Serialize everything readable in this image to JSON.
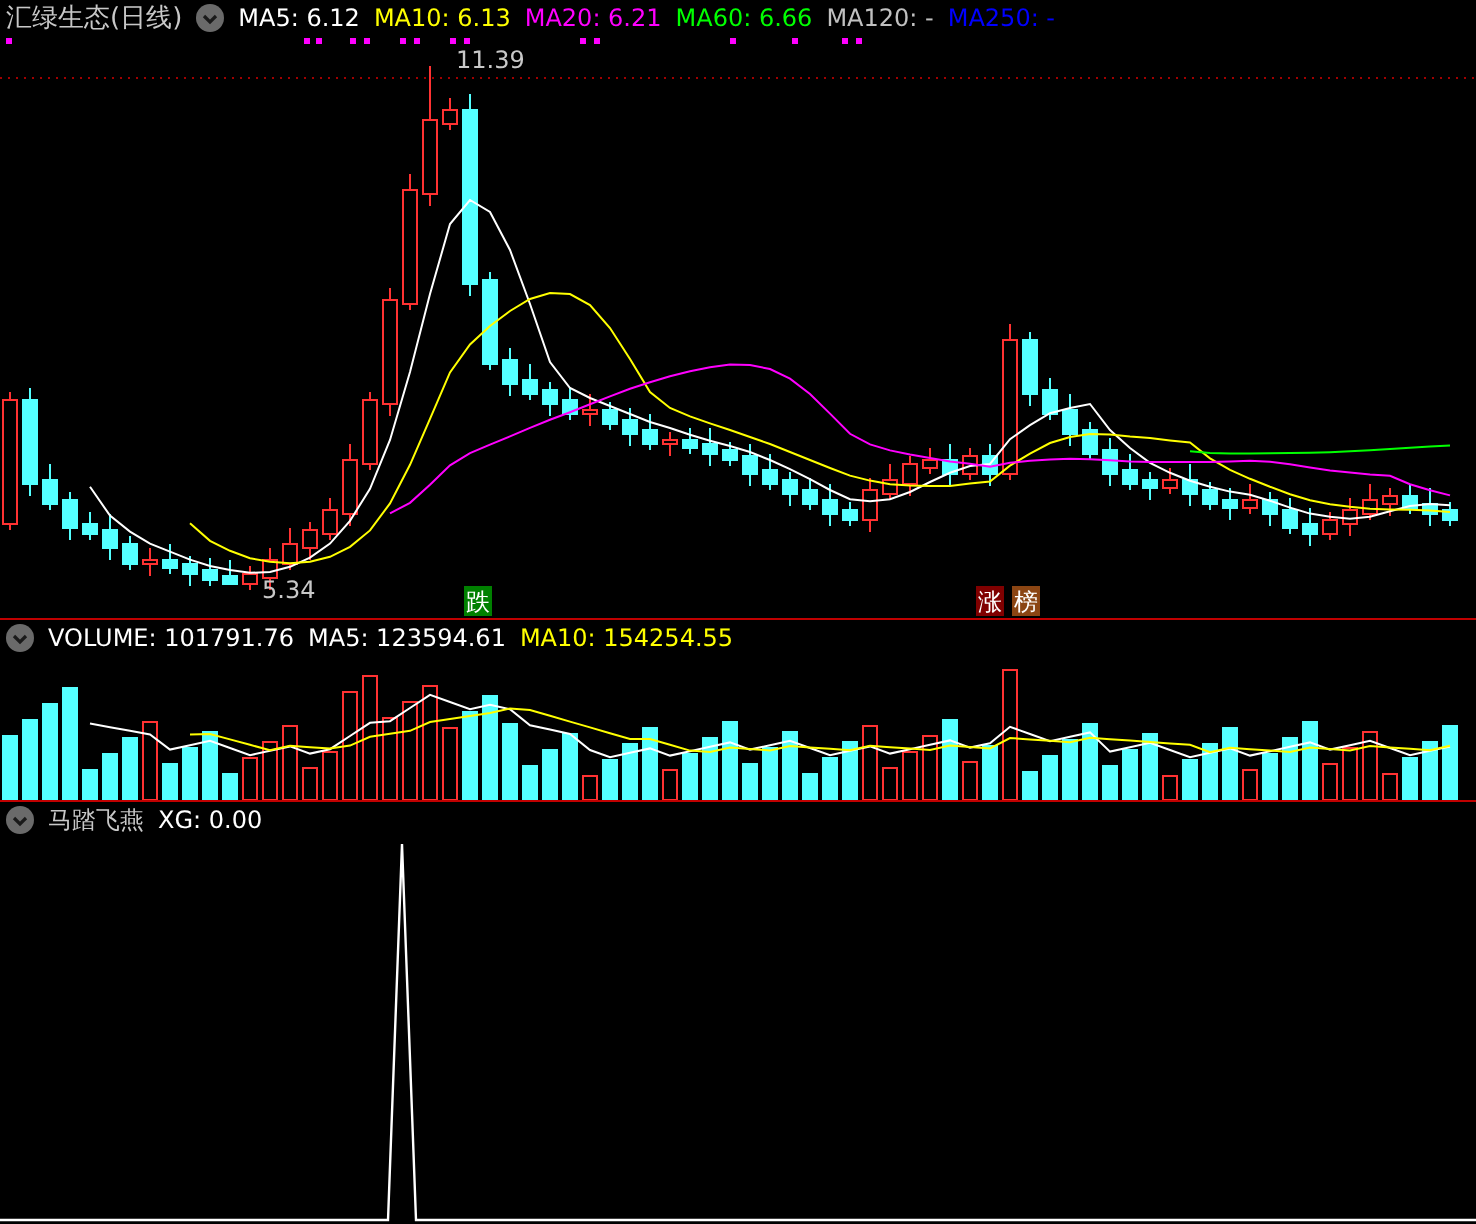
{
  "title": "汇绿生态(日线)",
  "price_legend": [
    {
      "label": "MA5: 6.12",
      "color": "#ffffff"
    },
    {
      "label": "MA10: 6.13",
      "color": "#ffff00"
    },
    {
      "label": "MA20: 6.21",
      "color": "#ff00ff"
    },
    {
      "label": "MA60: 6.66",
      "color": "#00ff00"
    },
    {
      "label": "MA120: -",
      "color": "#c0c0c0"
    },
    {
      "label": "MA250: -",
      "color": "#0000ff"
    }
  ],
  "price_annotations": [
    {
      "text": "11.39"
    },
    {
      "text": "5.34"
    }
  ],
  "signals": [
    {
      "text": "跌",
      "color": "#008000"
    },
    {
      "text": "涨",
      "color": "#800000"
    },
    {
      "text": "榜",
      "color": "#8b4513"
    }
  ],
  "volume_legend": [
    {
      "label": "VOLUME: 101791.76",
      "color": "#ffffff"
    },
    {
      "label": "MA5: 123594.61",
      "color": "#ffffff"
    },
    {
      "label": "MA10: 154254.55",
      "color": "#ffff00"
    }
  ],
  "indicator": {
    "name": "马踏飞燕",
    "legend": "XG: 0.00"
  }
}
